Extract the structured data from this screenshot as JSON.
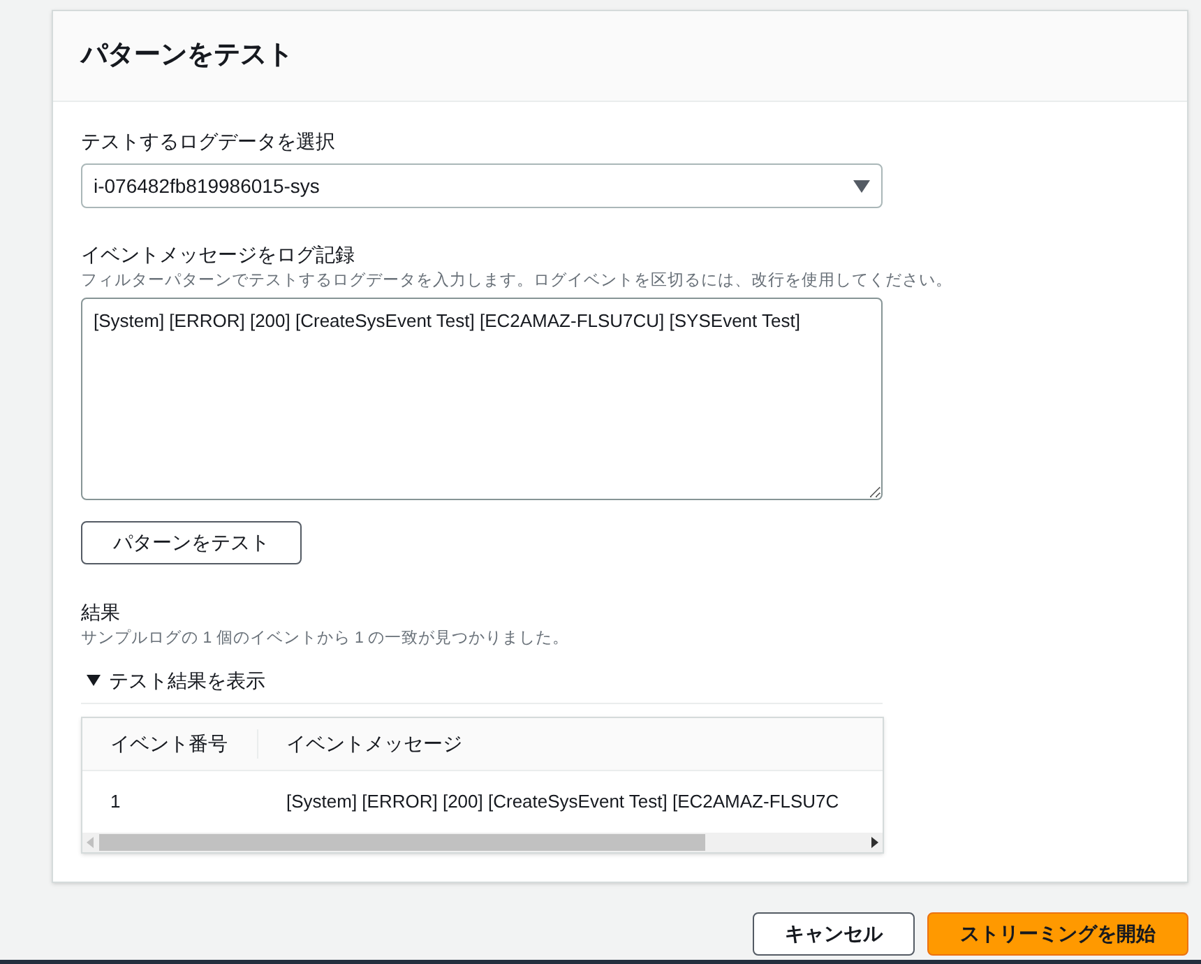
{
  "panel": {
    "title": "パターンをテスト"
  },
  "log_select": {
    "label": "テストするログデータを選択",
    "value": "i-076482fb819986015-sys"
  },
  "log_messages": {
    "label": "イベントメッセージをログ記録",
    "hint": "フィルターパターンでテストするログデータを入力します。ログイベントを区切るには、改行を使用してください。",
    "value": "[System] [ERROR] [200] [CreateSysEvent Test] [EC2AMAZ-FLSU7CU] [SYSEvent Test]"
  },
  "test_button": "パターンをテスト",
  "results": {
    "label": "結果",
    "summary": "サンプルログの 1 個のイベントから 1 の一致が見つかりました。",
    "details": {
      "label": "テスト結果を表示",
      "expanded": true
    },
    "table": {
      "columns": [
        "イベント番号",
        "イベントメッセージ"
      ],
      "rows": [
        [
          "1",
          "[System] [ERROR] [200] [CreateSysEvent Test] [EC2AMAZ-FLSU7C"
        ]
      ]
    }
  },
  "footer": {
    "buttons": [
      {
        "label": "キャンセル",
        "kind": "secondary"
      },
      {
        "label": "ストリーミングを開始",
        "kind": "primary"
      }
    ]
  }
}
